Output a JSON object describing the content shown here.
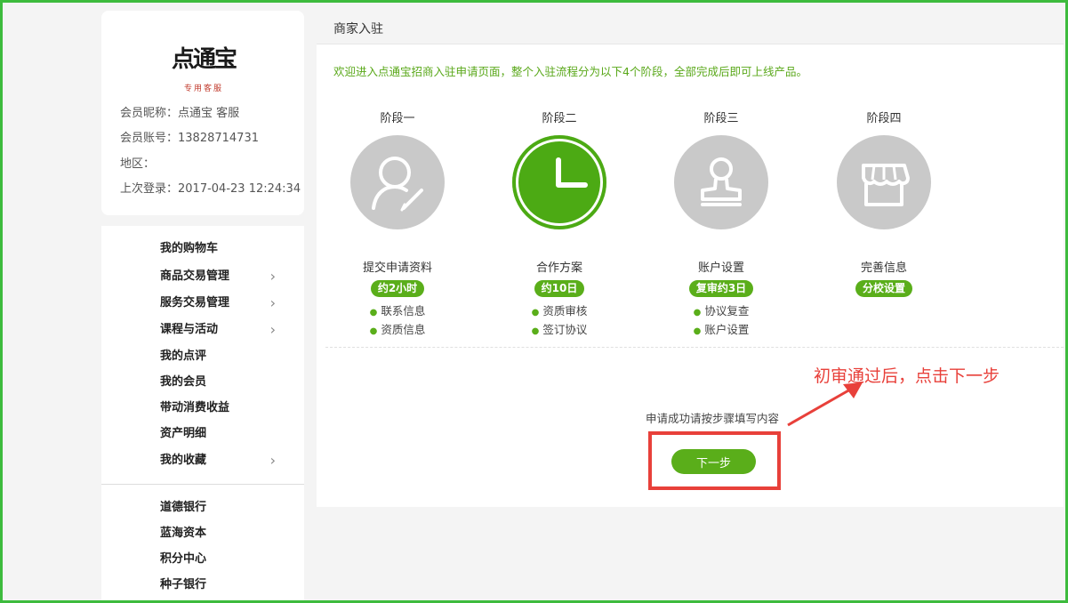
{
  "profile": {
    "logo_main": "点通宝",
    "logo_sub": "专用客服",
    "nickname_label": "会员昵称：",
    "nickname": "点通宝 客服",
    "account_label": "会员账号：",
    "account": "13828714731",
    "region_label": "地区：",
    "region": "",
    "last_login_label": "上次登录：",
    "last_login": "2017-04-23 12:24:34"
  },
  "nav": {
    "items": [
      {
        "label": "我的购物车",
        "chevron": false
      },
      {
        "label": "商品交易管理",
        "chevron": true
      },
      {
        "label": "服务交易管理",
        "chevron": true
      },
      {
        "label": "课程与活动",
        "chevron": true
      },
      {
        "label": "我的点评",
        "chevron": false
      },
      {
        "label": "我的会员",
        "chevron": false
      },
      {
        "label": "带动消费收益",
        "chevron": false
      },
      {
        "label": "资产明细",
        "chevron": false
      },
      {
        "label": "我的收藏",
        "chevron": true
      }
    ],
    "items2": [
      {
        "label": "道德银行"
      },
      {
        "label": "蓝海资本"
      },
      {
        "label": "积分中心"
      },
      {
        "label": "种子银行"
      }
    ],
    "chevron_glyph": "›"
  },
  "main": {
    "title": "商家入驻",
    "welcome": "欢迎进入点通宝招商入驻申请页面，整个入驻流程分为以下4个阶段，全部完成后即可上线产品。",
    "stages": [
      {
        "label": "阶段一",
        "icon": "user-edit-icon",
        "name": "提交申请资料",
        "pill": "约2小时",
        "bullets": [
          "联系信息",
          "资质信息"
        ]
      },
      {
        "label": "阶段二",
        "icon": "clock-icon",
        "name": "合作方案",
        "pill": "约10日",
        "bullets": [
          "资质审核",
          "签订协议"
        ]
      },
      {
        "label": "阶段三",
        "icon": "stamp-icon",
        "name": "账户设置",
        "pill": "复审约3日",
        "bullets": [
          "协议复查",
          "账户设置"
        ]
      },
      {
        "label": "阶段四",
        "icon": "store-icon",
        "name": "完善信息",
        "pill": "分校设置",
        "bullets": []
      }
    ],
    "active_stage": 2,
    "apply_tip": "申请成功请按步骤填写内容",
    "next_label": "下一步",
    "bullet_glyph": "●"
  },
  "annotation": {
    "text": "初审通过后，点击下一步",
    "color": "#e8403a"
  },
  "colors": {
    "accent": "#5aae1a",
    "inactive_circle": "#c9c9c9",
    "frame": "#3dbb3d"
  }
}
